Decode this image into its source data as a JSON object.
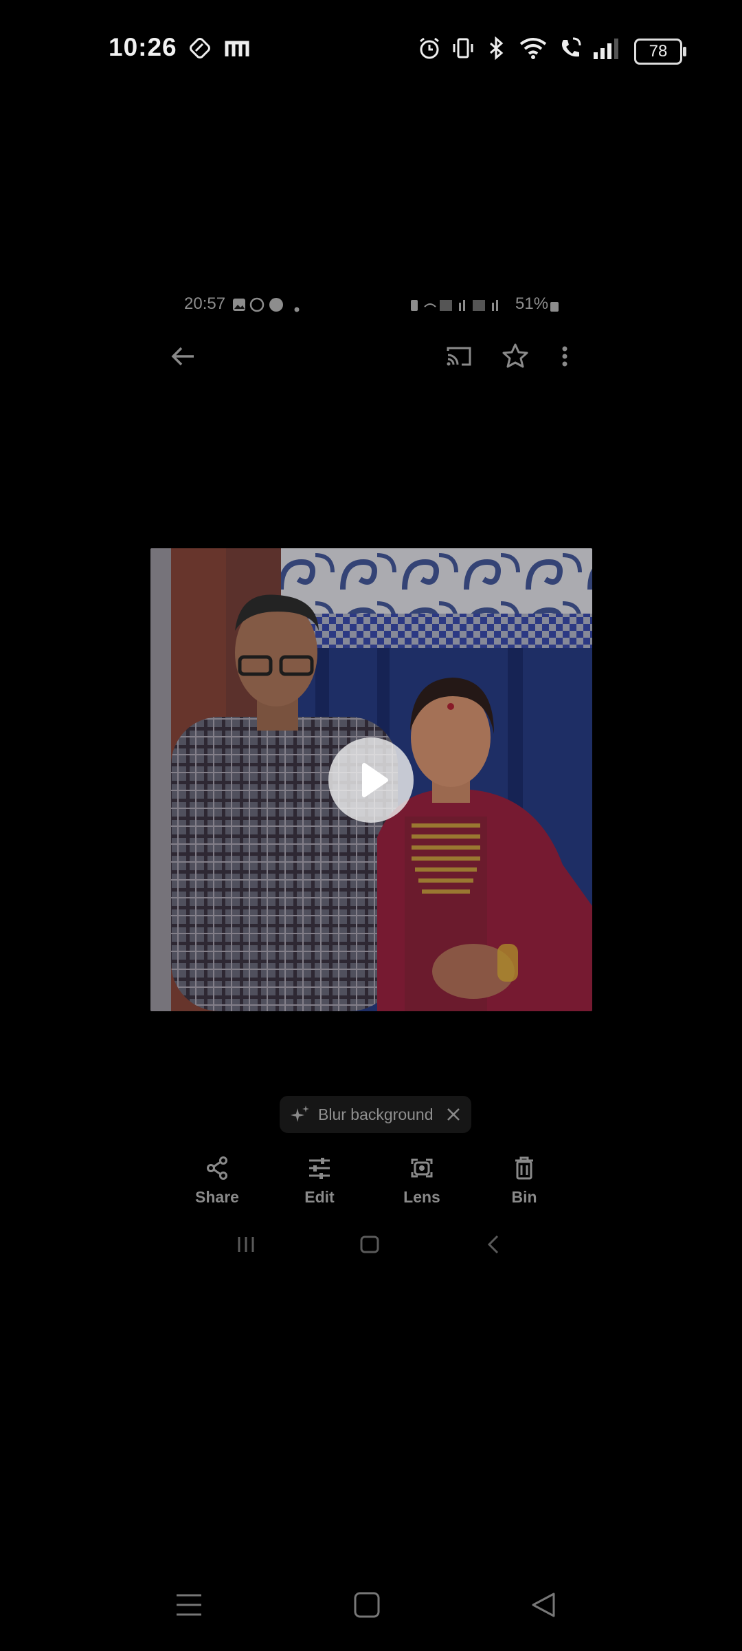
{
  "status_bar": {
    "time": "10:26",
    "battery": "78",
    "icons": [
      "lens-app-icon",
      "m-app-icon",
      "alarm-icon",
      "vibrate-icon",
      "bluetooth-icon",
      "wifi-icon",
      "wifi-call-icon",
      "signal-icon"
    ]
  },
  "inner_status": {
    "time": "20:57",
    "battery": "51%"
  },
  "top_bar": {
    "icons": [
      "back-arrow-icon",
      "cast-icon",
      "star-icon",
      "more-vert-icon"
    ]
  },
  "media": {
    "type": "video",
    "play_icon": "play-icon"
  },
  "suggestion_chip": {
    "label": "Blur background"
  },
  "actions": [
    {
      "label": "Share",
      "icon": "share-icon"
    },
    {
      "label": "Edit",
      "icon": "tune-icon"
    },
    {
      "label": "Lens",
      "icon": "lens-icon"
    },
    {
      "label": "Bin",
      "icon": "trash-icon"
    }
  ],
  "colors": {
    "background": "#000000",
    "dim_text": "#8a8a8a"
  }
}
